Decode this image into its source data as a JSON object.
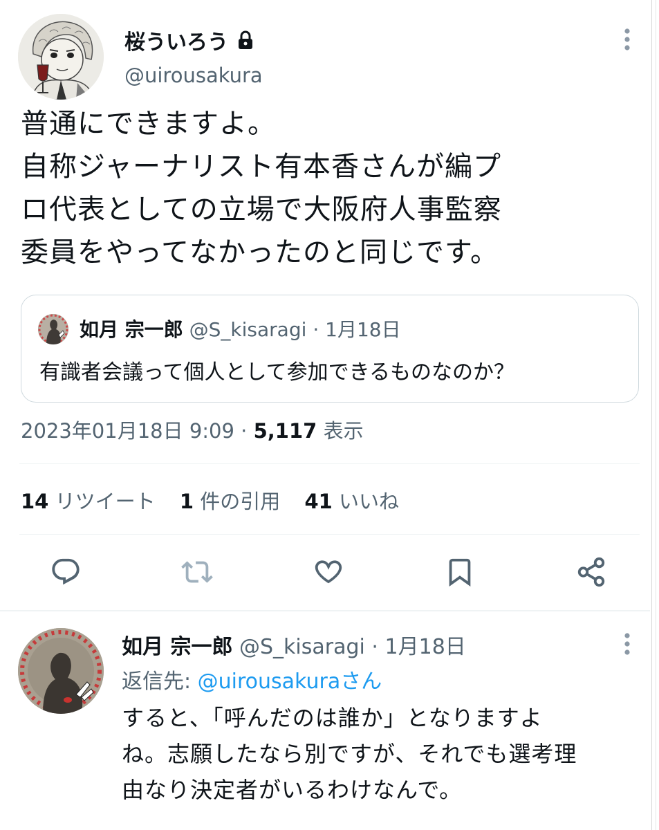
{
  "main_tweet": {
    "author_name": "桜ういろう",
    "author_handle": "@uirousakura",
    "text": "普通にできますよ。\n自称ジャーナリスト有本香さんが編プ\nロ代表としての立場で大阪府人事監察\n委員をやってなかったのと同じです。",
    "quote": {
      "author_name": "如月 宗一郎",
      "author_handle": "@S_kisaragi",
      "separator": "·",
      "date": "1月18日",
      "text": "有識者会議って個人として参加できるものなのか？"
    },
    "timestamp": "2023年01月18日 9:09",
    "meta_separator": "·",
    "views_count": "5,117",
    "views_label": "表示",
    "stats": {
      "retweets_count": "14",
      "retweets_label": "リツイート",
      "quotes_count": "1",
      "quotes_label": "件の引用",
      "likes_count": "41",
      "likes_label": "いいね"
    },
    "actions": [
      "reply-icon",
      "retweet-icon",
      "like-icon",
      "bookmark-icon",
      "share-icon"
    ]
  },
  "reply_tweet": {
    "author_name": "如月 宗一郎",
    "author_handle": "@S_kisaragi",
    "separator": "·",
    "date": "1月18日",
    "reply_prefix": "返信先: ",
    "reply_to": "@uirousakuraさん",
    "text": "すると、「呼んだのは誰か」となりますよ\nね。志願したなら別ですが、それでも選考理\n由なり決定者がいるわけなんで。"
  },
  "colors": {
    "text_primary": "#0f1419",
    "text_secondary": "#536471",
    "link": "#1d9bf0",
    "border": "#cfd9de",
    "action_icon": "#536471"
  }
}
